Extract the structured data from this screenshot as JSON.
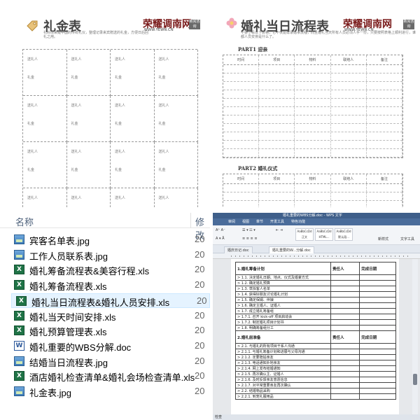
{
  "gift_table": {
    "title": "礼金表",
    "desc": "礼尚往来是中国的传统礼仪，整理记录来宾赠送的礼金，方便日后回礼之用。",
    "brand": "荣耀调南网",
    "brand_url": "WWW.YEWN.CN",
    "brand_badge": "新闻咨询",
    "cell_guest": "送礼人",
    "cell_money": "礼金"
  },
  "schedule": {
    "title": "婚礼当日流程表",
    "desc": "不要小看以下表格，它不仅能帮录婚事流程，而且婚礼当天所有人员必须人手一份，只要按照表格上顺利进行，谁都人员安排是什么了。",
    "brand": "荣耀调南网",
    "brand_url": "WWW.YEWN.CN",
    "brand_badge": "新闻咨询",
    "part1": "PART1 迎亲",
    "part2": "PART2 婚礼仪式",
    "columns": [
      "时间",
      "项目",
      "物料",
      "联络人",
      "备注"
    ]
  },
  "file_list": {
    "col_name": "名称",
    "col_modified": "修改",
    "files": [
      {
        "name": "宾客名单表.jpg",
        "type": "jpg",
        "date": "20"
      },
      {
        "name": "工作人员联系表.jpg",
        "type": "jpg",
        "date": "20"
      },
      {
        "name": "婚礼筹备流程表&美容行程.xls",
        "type": "xls",
        "date": "20"
      },
      {
        "name": "婚礼筹备流程表.xls",
        "type": "xls",
        "date": "20"
      },
      {
        "name": "婚礼当日流程表&婚礼人员安排.xls",
        "type": "xls",
        "date": "20"
      },
      {
        "name": "婚礼当天时间安排.xls",
        "type": "xls",
        "date": "20"
      },
      {
        "name": "婚礼预算管理表.xls",
        "type": "xls",
        "date": "20"
      },
      {
        "name": "婚礼重要的WBS分解.doc",
        "type": "doc",
        "date": "20"
      },
      {
        "name": "结婚当日流程表.jpg",
        "type": "jpg",
        "date": "20"
      },
      {
        "name": "酒店婚礼检查清单&婚礼会场检查清单.xls",
        "type": "xls",
        "date": "20"
      },
      {
        "name": "礼金表.jpg",
        "type": "jpg",
        "date": "20"
      }
    ],
    "selected_index": 4,
    "icon_labels": {
      "xls": "X",
      "doc": "W"
    }
  },
  "wps": {
    "window_title": "婚礼重要的WBS分解.doc - WPS 文字",
    "menus": [
      "审阅",
      "视图",
      "章节",
      "开发工具",
      "特色功能"
    ],
    "tabs": [
      "婚庆日记.doc",
      "婚礼重要的W...分解.doc"
    ],
    "style_samples": [
      "AaBbCcDd",
      "AaBbCcDd",
      "AaBbCcDd"
    ],
    "style_names": [
      "正文",
      "HTML...",
      "默认段..."
    ],
    "new_style": "新样式",
    "text_tools": "文字工具",
    "status": "检查",
    "section1": "1.婚礼筹备计划",
    "section2": "2.婚礼前准备",
    "col_owner": "责任人",
    "col_done": "完成日期",
    "tasks1": [
      "> 1.1. 决定婚礼日期、地点、仪式及婚宴方式",
      "> 1.2. 确定婚礼预算",
      "> 1.3. 草拟客人名单",
      "> 1.4. 获得好朋友讨论婚礼计划",
      "> 1.5. 确定保姆、伴娘",
      "> 1.6. 确定主婚人、证婚人",
      "> 1.7. 成立婚礼筹备组",
      "> 1.7.1. 召开 kick-off 项目启动会",
      "> 1.7.2. 制定婚礼项目计划书",
      "> 1.8. 明确筹备组分工"
    ],
    "tasks2": [
      "> 2.1. 与婚礼的所有项目干系人沟通",
      "> 2.1.1. 与婚礼筹备计划和进展与父母沟通",
      "> 2.1.2. 定要陪姑亲友",
      "> 2.1.3. 电话通知外地亲友",
      "> 2.1.4. 网上发布结婚通知",
      "> 2.1.5. 再次确认主、证婚人",
      "> 2.1.6. 及时反馈亲友意愿信息",
      "> 2.1.7. 对平常重要亲友再次确认",
      "> 2.2. 结婚物品采购",
      "> 2.2.1. 到宠礼服用品"
    ]
  }
}
